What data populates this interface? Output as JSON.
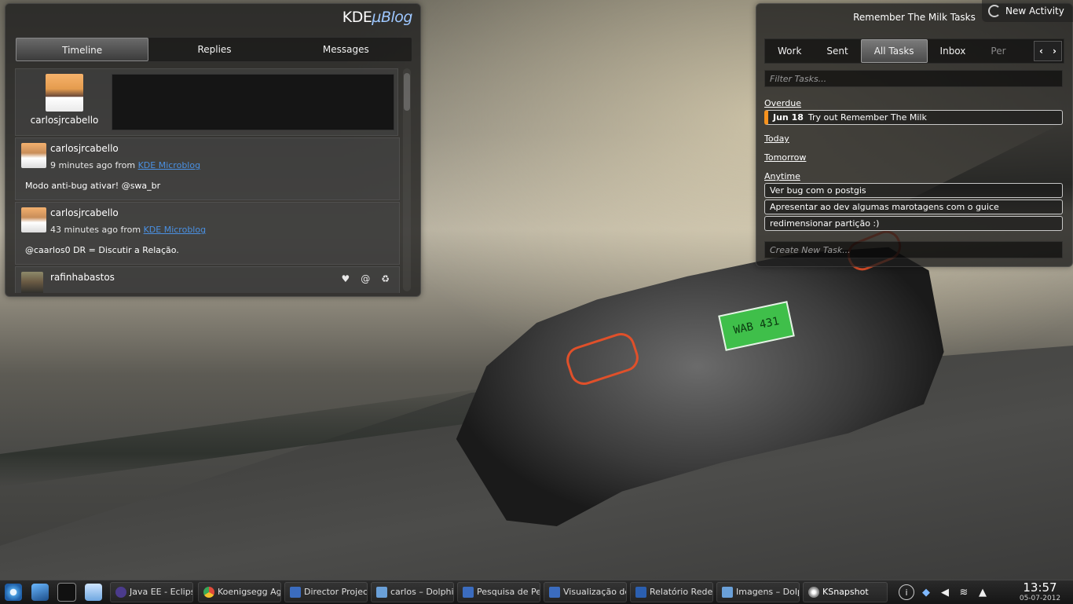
{
  "microblog": {
    "logo_main": "KDE",
    "logo_accent": "µBlog",
    "tabs": [
      {
        "label": "Timeline"
      },
      {
        "label": "Replies"
      },
      {
        "label": "Messages"
      }
    ],
    "compose_user": "carlosjrcabello",
    "tweets": [
      {
        "user": "carlosjrcabello",
        "time": "9 minutes ago from",
        "source": "KDE Microblog",
        "text": "Modo anti-bug ativar! @swa_br"
      },
      {
        "user": "carlosjrcabello",
        "time": "43 minutes ago from",
        "source": "KDE Microblog",
        "text": "@caarlos0 DR = Discutir a Relação."
      },
      {
        "user": "rafinhabastos",
        "time": "",
        "source": "",
        "text": ""
      }
    ],
    "actions": {
      "favorite": "♥",
      "reply": "@",
      "retweet": "♻"
    }
  },
  "rtm": {
    "title": "Remember The Milk Tasks",
    "tabs": [
      {
        "label": "Work"
      },
      {
        "label": "Sent"
      },
      {
        "label": "All Tasks"
      },
      {
        "label": "Inbox"
      },
      {
        "label": "Per"
      }
    ],
    "prev_label": "‹",
    "next_label": "›",
    "filter_placeholder": "Filter Tasks...",
    "sections": {
      "overdue": "Overdue",
      "today": "Today",
      "tomorrow": "Tomorrow",
      "anytime": "Anytime"
    },
    "overdue_tasks": [
      {
        "date": "Jun 18",
        "text": "Try out Remember The Milk"
      }
    ],
    "anytime_tasks": [
      {
        "text": "Ver bug com o postgis"
      },
      {
        "text": "Apresentar ao dev algumas marotagens com o guice"
      },
      {
        "text": "redimensionar partição :)"
      }
    ],
    "create_placeholder": "Create New Task..."
  },
  "new_activity": {
    "label": "New Activity"
  },
  "wallpaper": {
    "plate": "WAB 431"
  },
  "taskbar": {
    "tasks": [
      {
        "label": "Java EE - Eclipse",
        "color": "#4b3b8c"
      },
      {
        "label": "Koenigsegg Agera",
        "color": "#e04a3a"
      },
      {
        "label": "Director Project",
        "color": "#3b6cbf"
      },
      {
        "label": "carlos – Dolphin",
        "color": "#3b6cbf"
      },
      {
        "label": "Pesquisa de Per",
        "color": "#3b6cbf"
      },
      {
        "label": "Visualização de",
        "color": "#3b6cbf"
      },
      {
        "label": "Relatório Redes",
        "color": "#3b6cbf"
      },
      {
        "label": "Imagens – Dolphin",
        "color": "#3b6cbf"
      },
      {
        "label": "KSnapshot",
        "color": "#888888"
      }
    ],
    "tray_icons": [
      "info-icon",
      "dropbox-icon",
      "volume-icon",
      "wifi-icon",
      "expand-tray-icon"
    ],
    "clock_time": "13:57",
    "clock_date": "05-07-2012"
  }
}
